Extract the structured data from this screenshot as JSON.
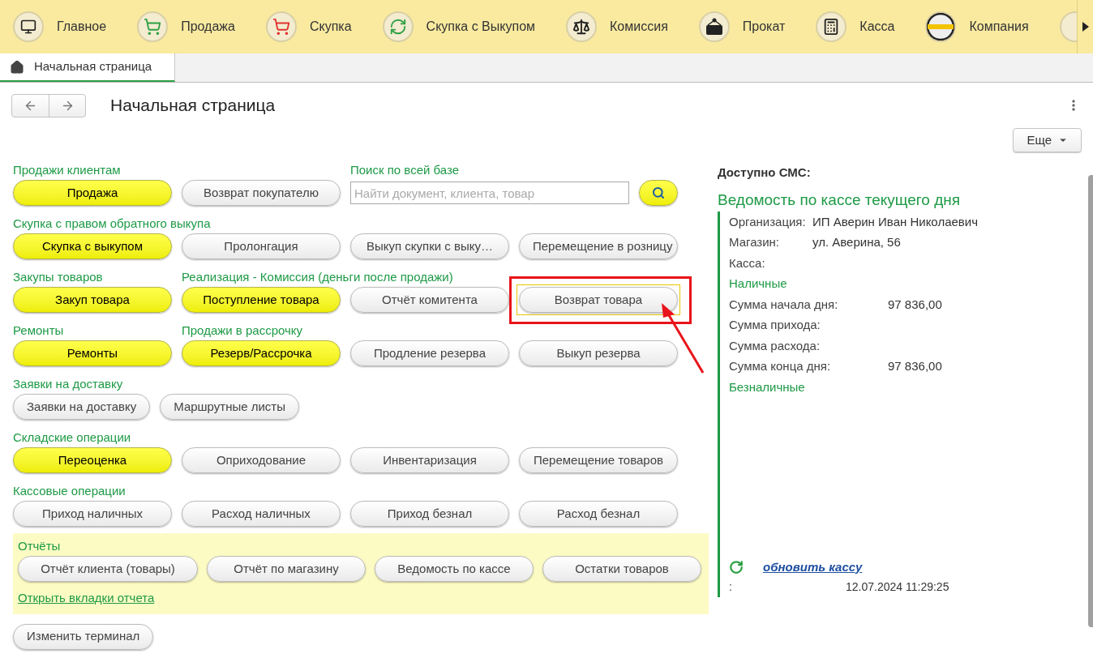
{
  "nav": {
    "items": [
      {
        "label": "Главное",
        "selected": false
      },
      {
        "label": "Продажа",
        "selected": false
      },
      {
        "label": "Скупка",
        "selected": false
      },
      {
        "label": "Скупка с Выкупом",
        "selected": false
      },
      {
        "label": "Комиссия",
        "selected": false
      },
      {
        "label": "Прокат",
        "selected": false
      },
      {
        "label": "Касса",
        "selected": false
      },
      {
        "label": "Компания",
        "selected": false
      }
    ]
  },
  "tabs": [
    {
      "label": "Начальная страница",
      "selected": true
    }
  ],
  "page": {
    "title": "Начальная страница",
    "more_button": "Еще"
  },
  "rows": [
    {
      "kind": "grid",
      "cells": [
        {
          "kind": "button",
          "label": "Продажи клиентам",
          "text": "Продажа",
          "highlighted": true
        },
        {
          "kind": "button",
          "text": "Возврат покупателю",
          "highlighted": false
        },
        {
          "kind": "search",
          "label": "Поиск по всей базе",
          "placeholder": "Найти документ, клиента, товар"
        }
      ]
    },
    {
      "kind": "grid",
      "cells": [
        {
          "kind": "button",
          "label": "Скупка с правом обратного выкупа",
          "text": "Скупка с выкупом",
          "highlighted": true
        },
        {
          "kind": "button",
          "text": "Пролонгация",
          "highlighted": false
        },
        {
          "kind": "button",
          "text": "Выкуп скупки с выку…",
          "highlighted": false
        },
        {
          "kind": "button",
          "text": "Перемещение в розницу",
          "highlighted": false
        }
      ]
    },
    {
      "kind": "grid",
      "cells": [
        {
          "kind": "button",
          "label": "Закупы товаров",
          "text": "Закуп товара",
          "highlighted": true
        },
        {
          "kind": "button",
          "label": "Реализация - Комиссия (деньги после продажи)",
          "text": "Поступление товара",
          "highlighted": true
        },
        {
          "kind": "button",
          "text": "Отчёт комитента",
          "highlighted": false
        },
        {
          "kind": "button",
          "text": "Возврат товара",
          "highlighted": false,
          "annotated": true
        }
      ]
    },
    {
      "kind": "grid",
      "cells": [
        {
          "kind": "button",
          "label": "Ремонты",
          "text": "Ремонты",
          "highlighted": true
        },
        {
          "kind": "button",
          "label": "Продажи в рассрочку",
          "text": "Резерв/Рассрочка",
          "highlighted": true
        },
        {
          "kind": "button",
          "text": "Продление резерва",
          "highlighted": false
        },
        {
          "kind": "button",
          "text": "Выкуп резерва",
          "highlighted": false
        }
      ]
    },
    {
      "kind": "inline",
      "label": "Заявки на доставку",
      "cells": [
        {
          "kind": "button",
          "text": "Заявки на доставку",
          "highlighted": false
        },
        {
          "kind": "button",
          "text": "Маршрутные листы",
          "highlighted": false
        }
      ]
    },
    {
      "kind": "grid",
      "cells": [
        {
          "kind": "button",
          "label": "Складские операции",
          "text": "Переоценка",
          "highlighted": true
        },
        {
          "kind": "button",
          "text": "Оприходование",
          "highlighted": false
        },
        {
          "kind": "button",
          "text": "Инвентаризация",
          "highlighted": false
        },
        {
          "kind": "button",
          "text": "Перемещение товаров",
          "highlighted": false
        }
      ]
    },
    {
      "kind": "grid",
      "cells": [
        {
          "kind": "button",
          "label": "Кассовые операции",
          "text": "Приход наличных",
          "highlighted": false
        },
        {
          "kind": "button",
          "text": "Расход наличных",
          "highlighted": false
        },
        {
          "kind": "button",
          "text": "Приход безнал",
          "highlighted": false
        },
        {
          "kind": "button",
          "text": "Расход безнал",
          "highlighted": false
        }
      ]
    }
  ],
  "reports": {
    "title": "Отчёты",
    "buttons": [
      {
        "text": "Отчёт клиента (товары)",
        "highlighted": false
      },
      {
        "text": "Отчёт по магазину",
        "highlighted": false
      },
      {
        "text": "Ведомость по кассе",
        "highlighted": false
      },
      {
        "text": "Остатки товаров",
        "highlighted": false
      }
    ],
    "link": "Открыть вкладки отчета"
  },
  "terminal_button": {
    "text": "Изменить терминал",
    "highlighted": false
  },
  "statement": {
    "sms_label": "Доступно СМС:",
    "title": "Ведомость по кассе текущего дня",
    "details": [
      {
        "label": "Организация:",
        "value": "ИП Аверин Иван Николаевич"
      },
      {
        "label": "Магазин:",
        "value": "ул. Аверина, 56"
      },
      {
        "label": "Касса:"
      }
    ],
    "groups": [
      {
        "title": "Наличные",
        "rows": [
          {
            "label": "Сумма начала дня:",
            "value": "97 836,00"
          },
          {
            "label": "Сумма прихода:"
          },
          {
            "label": "Сумма расхода:"
          },
          {
            "label": "Сумма конца дня:",
            "value": "97 836,00"
          }
        ]
      },
      {
        "title": "Безналичные"
      }
    ],
    "refresh_link": "обновить кассу",
    "timestamp": {
      "label": ":",
      "value": "12.07.2024 11:29:25"
    }
  }
}
